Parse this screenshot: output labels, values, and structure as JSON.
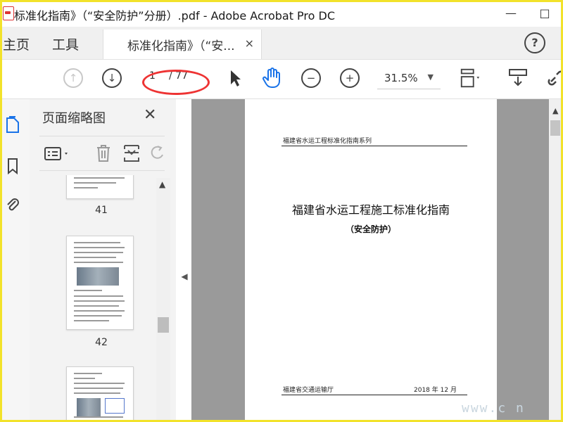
{
  "window": {
    "title": "标准化指南》（“安全防护”分册）.pdf - Adobe Acrobat Pro DC",
    "minimize": "—",
    "maximize": "□"
  },
  "tabs": {
    "home": "主页",
    "tools": "工具",
    "document": "标准化指南》（“安...",
    "close": "×",
    "help": "?"
  },
  "toolbar": {
    "current_page": "1",
    "total_pages": "/ 77",
    "zoom": "31.5%",
    "zoom_arrow": "▼",
    "zoom_in": "+",
    "zoom_out": "−",
    "page_up": "↑",
    "page_down": "↓"
  },
  "panel": {
    "title": "页面缩略图",
    "close": "✕",
    "thumb_labels": [
      "41",
      "42"
    ]
  },
  "page": {
    "header": "福建省水运工程标准化指南系列",
    "title": "福建省水运工程施工标准化指南",
    "subtitle": "（安全防护）",
    "footer_left": "福建省交通运输厅",
    "footer_right": "2018 年 12 月"
  },
  "watermark": "www.c      n",
  "colors": {
    "frame": "#f2e22a",
    "annotation": "#e33333",
    "hand_tool": "#1a73e8",
    "doc_bg": "#9a9a9a"
  }
}
